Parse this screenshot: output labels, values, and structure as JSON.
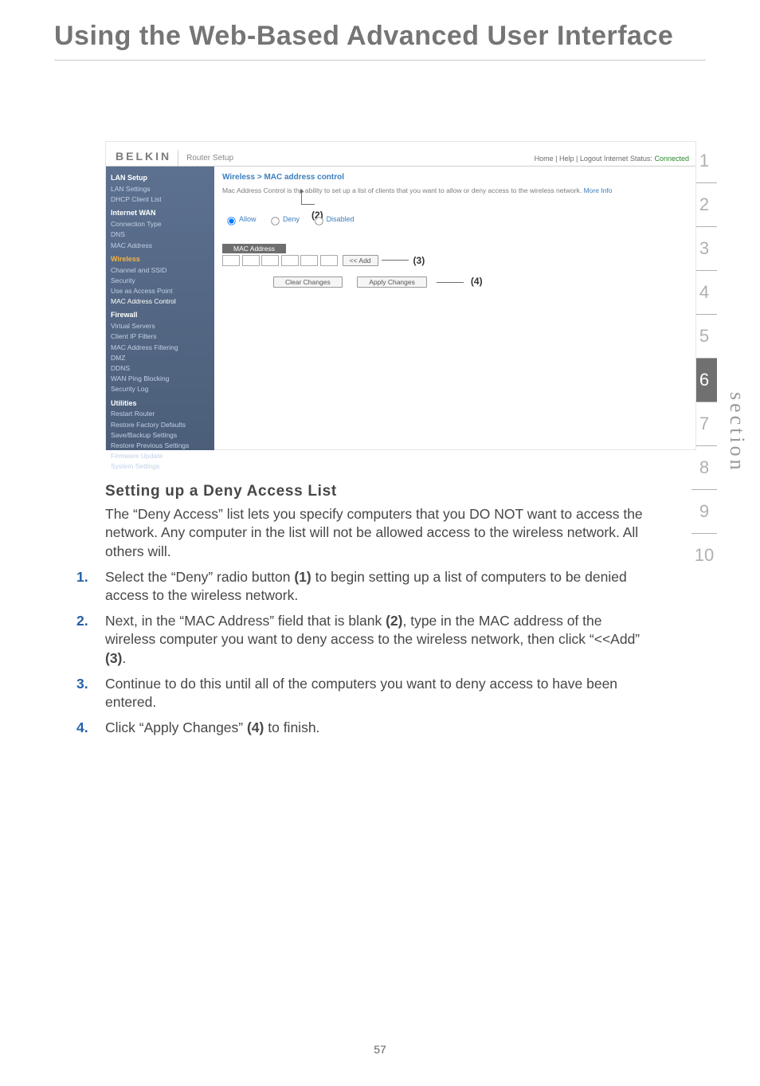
{
  "page_title": "Using the Web-Based Advanced User Interface",
  "section_label": "section",
  "section_tabs": [
    "1",
    "2",
    "3",
    "4",
    "5",
    "6",
    "7",
    "8",
    "9",
    "10"
  ],
  "section_active": "6",
  "router": {
    "brand": "BELKIN",
    "title": "Router Setup",
    "header_links": "Home | Help | Logout   Internet Status:",
    "status_value": "Connected",
    "sidebar": {
      "groups": [
        {
          "label": "LAN Setup",
          "items": [
            "LAN Settings",
            "DHCP Client List"
          ]
        },
        {
          "label": "Internet WAN",
          "items": [
            "Connection Type",
            "DNS",
            "MAC Address"
          ]
        },
        {
          "label": "Wireless",
          "sel": true,
          "items": [
            "Channel and SSID",
            "Security",
            "Use as Access Point",
            "MAC Address Control"
          ],
          "current": "MAC Address Control"
        },
        {
          "label": "Firewall",
          "items": [
            "Virtual Servers",
            "Client IP Filters",
            "MAC Address Filtering",
            "DMZ",
            "DDNS",
            "WAN Ping Blocking",
            "Security Log"
          ]
        },
        {
          "label": "Utilities",
          "items": [
            "Restart Router",
            "Restore Factory Defaults",
            "Save/Backup Settings",
            "Restore Previous Settings",
            "Firmware Update",
            "System Settings"
          ]
        }
      ]
    },
    "breadcrumb": "Wireless > MAC address control",
    "description_pre": "Mac Address Control is the ability to set up a list of clients that you want to allow or deny access to the wireless network.",
    "more_info": "More Info",
    "radios": {
      "allow": "Allow",
      "deny": "Deny",
      "disabled": "Disabled"
    },
    "mac_label": "MAC Address",
    "add_btn": "<< Add",
    "clear_btn": "Clear Changes",
    "apply_btn": "Apply Changes",
    "callouts": {
      "two": "(2)",
      "three": "(3)",
      "four": "(4)"
    }
  },
  "body": {
    "heading": "Setting up a Deny Access List",
    "intro": "The “Deny Access” list lets you specify computers that you DO NOT want to access the network. Any computer in the list will not be allowed access to the wireless network. All others will.",
    "steps": [
      {
        "num": "1.",
        "text_a": "Select the “Deny” radio button ",
        "bold_a": "(1)",
        "text_b": " to begin setting up a list of computers to be denied access to the wireless network."
      },
      {
        "num": "2.",
        "text_a": "Next, in the “MAC Address” field that is blank ",
        "bold_a": "(2)",
        "text_b": ", type in the MAC address of the wireless computer you want to deny access to the wireless network, then click “<<Add” ",
        "bold_b": "(3)",
        "text_c": "."
      },
      {
        "num": "3.",
        "text_a": "Continue to do this until all of the computers you want to deny access to have been entered."
      },
      {
        "num": "4.",
        "text_a": "Click “Apply Changes” ",
        "bold_a": "(4)",
        "text_b": " to finish."
      }
    ]
  },
  "page_number": "57"
}
